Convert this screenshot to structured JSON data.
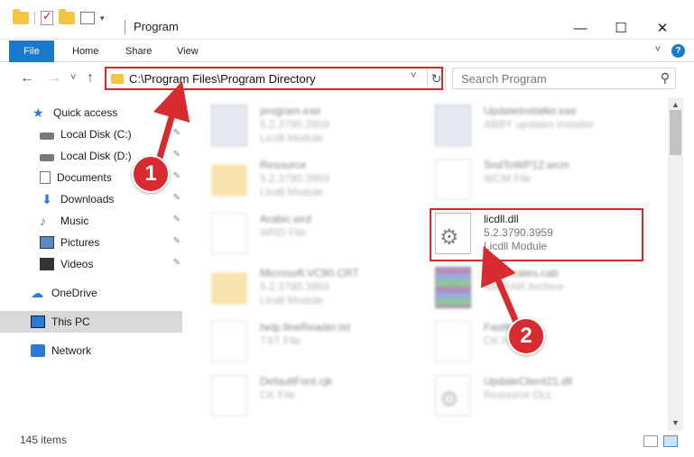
{
  "window": {
    "title": "Program",
    "controls": {
      "minimize": "—",
      "maximize": "☐",
      "close": "✕"
    }
  },
  "ribbon": {
    "tabs": [
      "File",
      "Home",
      "Share",
      "View"
    ],
    "collapse_icon": "˅",
    "help_icon": "?"
  },
  "nav": {
    "back": "←",
    "forward": "→",
    "recent": "˅",
    "up": "↑",
    "address": "C:\\Program Files\\Program Directory",
    "dropdown": "˅",
    "refresh": "↻",
    "search_placeholder": "Search Program",
    "search_icon": "⚲"
  },
  "sidebar": {
    "items": [
      {
        "label": "Quick access",
        "icon": "star-icon",
        "pinned": false
      },
      {
        "label": "Local Disk (C:)",
        "icon": "drive-icon",
        "pinned": true
      },
      {
        "label": "Local Disk (D:)",
        "icon": "drive-icon",
        "pinned": true
      },
      {
        "label": "Documents",
        "icon": "documents-icon",
        "pinned": true
      },
      {
        "label": "Downloads",
        "icon": "downloads-icon",
        "pinned": true
      },
      {
        "label": "Music",
        "icon": "music-icon",
        "pinned": true
      },
      {
        "label": "Pictures",
        "icon": "pictures-icon",
        "pinned": true
      },
      {
        "label": "Videos",
        "icon": "videos-icon",
        "pinned": true
      },
      {
        "label": "OneDrive",
        "icon": "cloud-icon",
        "pinned": false
      },
      {
        "label": "This PC",
        "icon": "computer-icon",
        "pinned": false,
        "selected": true
      },
      {
        "label": "Network",
        "icon": "network-icon",
        "pinned": false
      }
    ],
    "pin_glyph": "📌"
  },
  "files": [
    {
      "name": "program.exe",
      "line2": "5.2.3790.3959",
      "line3": "Licdll Module",
      "icon": "exe-icon"
    },
    {
      "name": "UpdateInstaller.exe",
      "line2": "ABBY updates installer",
      "line3": "",
      "icon": "exe-icon"
    },
    {
      "name": "Resource",
      "line2": "5.2.3790.3959",
      "line3": "Licdll Module",
      "icon": "folder-icon"
    },
    {
      "name": "SndToWP12.wcm",
      "line2": "WCM File",
      "line3": "",
      "icon": "document-icon"
    },
    {
      "name": "Arabic.wrd",
      "line2": "WRD File",
      "line3": "",
      "icon": "document-icon"
    },
    {
      "name": "licdll.dll",
      "line2": "5.2.3790.3959",
      "line3": "Licdll Module",
      "icon": "dll-icon"
    },
    {
      "name": "Microsoft.VC90.CRT",
      "line2": "5.2.3790.3959",
      "line3": "Licdll Module",
      "icon": "folder-icon"
    },
    {
      "name": "Certificates.cab",
      "line2": "WinRAR Archive",
      "line3": "",
      "icon": "archive-icon"
    },
    {
      "name": "help.fineReader.txt",
      "line2": "TXT File",
      "line3": "",
      "icon": "document-icon"
    },
    {
      "name": "FastKey",
      "line2": "CK File",
      "line3": "",
      "icon": "document-icon"
    },
    {
      "name": "DefaultFont.cjk",
      "line2": "CK File",
      "line3": "",
      "icon": "document-icon"
    },
    {
      "name": "UpdateClient21.dll",
      "line2": "Resource DLL",
      "line3": "",
      "icon": "dll-icon"
    }
  ],
  "status": {
    "item_count": "145 items"
  },
  "markers": {
    "step1": "1",
    "step2": "2"
  },
  "colors": {
    "accent": "#1979ca",
    "highlight_red": "#d9262b",
    "marker_red": "#d72b2f",
    "folder_yellow": "#f5c542"
  },
  "scrollbar": {
    "up": "▲",
    "down": "▼"
  }
}
